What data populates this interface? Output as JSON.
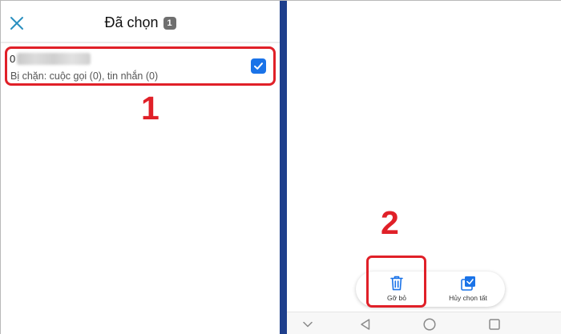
{
  "header": {
    "title": "Đã chọn",
    "count": "1",
    "close_icon": "close-icon"
  },
  "contact": {
    "name_prefix": "0",
    "name_blurred": true,
    "description": "Bị chặn: cuộc gọi (0), tin nhắn (0)",
    "checked": true,
    "check_icon": "checkbox-checked-icon"
  },
  "annotations": {
    "step1": "1",
    "step2": "2",
    "highlight_color": "#e02028"
  },
  "action_bar": {
    "delete_label": "Gỡ bỏ",
    "delete_icon": "trash-icon",
    "deselect_label": "Hủy chọn tất",
    "deselect_icon": "deselect-all-icon"
  },
  "navbar": {
    "icons": [
      "chevron-down-icon",
      "back-triangle-icon",
      "home-circle-icon",
      "recent-square-icon"
    ]
  },
  "colors": {
    "accent": "#1a73e8",
    "close_icon": "#2a8fc0",
    "divider": "#1e3f8c",
    "annotation": "#e02028"
  }
}
